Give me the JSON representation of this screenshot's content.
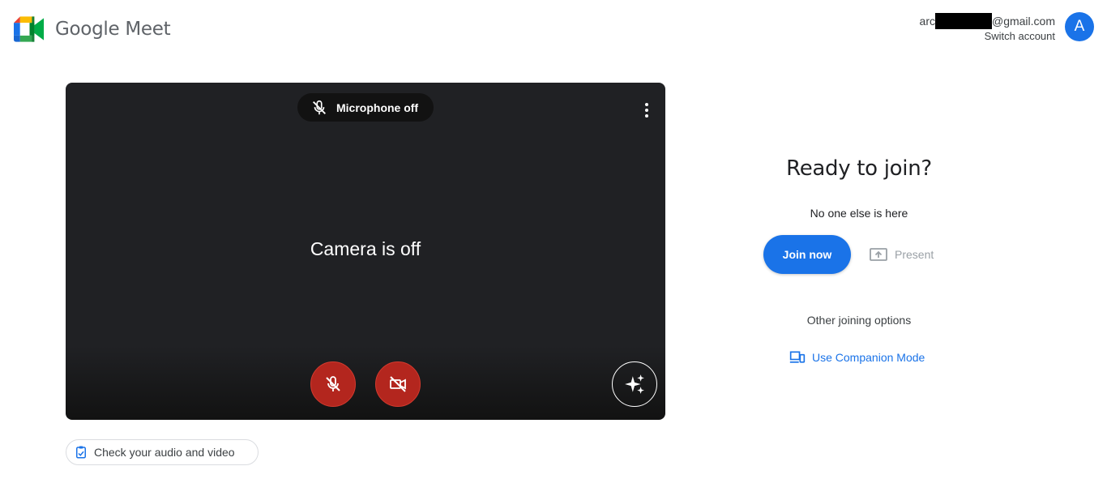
{
  "app": {
    "name": "Google Meet"
  },
  "account": {
    "email_prefix": "arc",
    "email_suffix": "@gmail.com",
    "switch_label": "Switch account",
    "avatar_initial": "A"
  },
  "preview": {
    "mic_status": "Microphone off",
    "camera_status": "Camera is off"
  },
  "check_av": {
    "label": "Check your audio and video"
  },
  "join": {
    "heading": "Ready to join?",
    "participants": "No one else is here",
    "join_label": "Join now",
    "present_label": "Present",
    "other_options": "Other joining options",
    "companion_label": "Use Companion Mode"
  },
  "colors": {
    "accent": "#1a73e8",
    "danger": "#b3261e",
    "preview_bg": "#202124"
  },
  "icons": [
    "meet-logo-icon",
    "mic-off-icon",
    "more-vert-icon",
    "camera-off-icon",
    "sparkle-icon",
    "checklist-icon",
    "present-icon",
    "companion-icon"
  ]
}
